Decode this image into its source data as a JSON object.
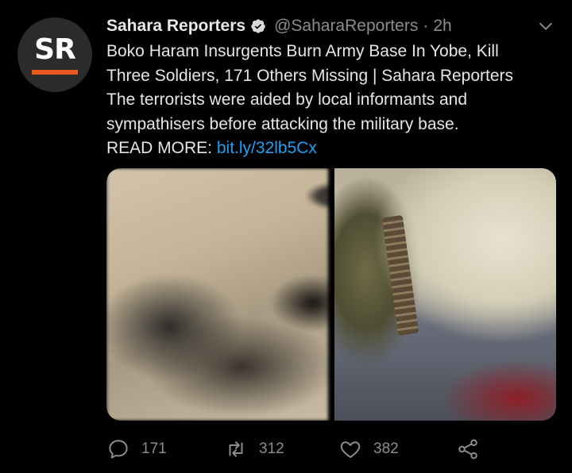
{
  "tweet": {
    "avatar_text": "SR",
    "name": "Sahara Reporters",
    "handle": "@SaharaReporters",
    "separator": "·",
    "time": "2h",
    "body_lines": [
      "Boko Haram Insurgents Burn Army Base In Yobe, Kill",
      "Three Soldiers, 171 Others Missing | Sahara Reporters",
      "The terrorists were aided by local informants and",
      "sympathisers before attacking the military base."
    ],
    "read_more_label": "READ MORE:",
    "link": "bit.ly/32lb5Cx",
    "replies": "171",
    "retweets": "312",
    "likes": "382"
  },
  "colors": {
    "accent": "#1da1f2",
    "brand": "#e85a1e",
    "muted": "#8a8d91"
  },
  "icons": {
    "verified": "verified-badge-icon",
    "menu": "chevron-down-icon",
    "reply": "comment-icon",
    "retweet": "retweet-icon",
    "like": "heart-icon",
    "share": "share-icon"
  }
}
